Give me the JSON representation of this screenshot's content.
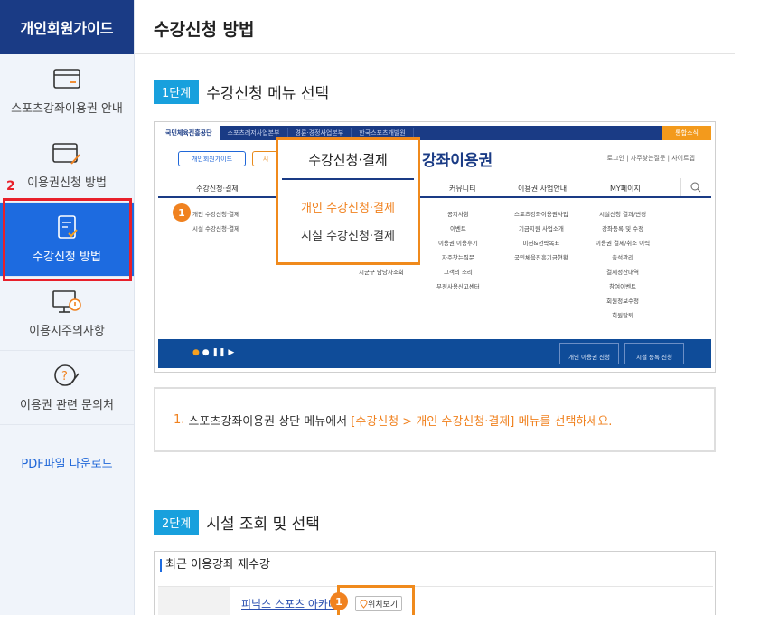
{
  "sidebar": {
    "header": "개인회원가이드",
    "step_marker": "2",
    "items": [
      {
        "label": "스포츠강좌이용권 안내"
      },
      {
        "label": "이용권신청 방법"
      },
      {
        "label": "수강신청 방법"
      },
      {
        "label": "이용시주의사항"
      },
      {
        "label": "이용권 관련 문의처"
      }
    ],
    "pdf": "PDF파일 다운로드",
    "active_index": 2
  },
  "main": {
    "title": "수강신청 방법",
    "step1": {
      "badge": "1단계",
      "title": "수강신청 메뉴 선택"
    },
    "step2": {
      "badge": "2단계",
      "title": "시설 조회 및 선택"
    }
  },
  "screenshot1": {
    "topbar": [
      "국민체육진흥공단",
      "스포츠레저사업본부",
      "경륜·경정사업본부",
      "한국스포츠개발원"
    ],
    "news": "통합소식",
    "guide_btn": "개인회원가이드",
    "guide_btn2": "시",
    "brand": "강좌이용권",
    "util": "로그인 | 자주찾는질문 | 사이트맵",
    "nav": [
      "수강신청·결제",
      "커뮤니티",
      "이용권 사업안내",
      "MY페이지"
    ],
    "col1": [
      "개인 수강신청·결제",
      "시설 수강신청·결제"
    ],
    "col_extra": "시군구 담당자조회",
    "col_community": [
      "공지사항",
      "이벤트",
      "이용권 이용후기",
      "자주찻는질문",
      "고객의 소리",
      "부정사용신고센터"
    ],
    "col_business": [
      "스포츠강좌이용권사업",
      "기금지원 사업소개",
      "미션&전략목표",
      "국민체육진흥기금현황"
    ],
    "col_my": [
      "시설신청 결과/변경",
      "강좌등록 및 수정",
      "이용권 결제/취소 이력",
      "출석관리",
      "결제정산내역",
      "참여이벤트",
      "회원정보수정",
      "회원탈퇴"
    ],
    "banner_btn1": "개인 이용권 신청",
    "banner_btn2": "시설 등록 신청",
    "badge": "1",
    "popup": {
      "title": "수강신청·결제",
      "link_active": "개인 수강신청·결제",
      "link_other": "시설 수강신청·결제"
    }
  },
  "description": {
    "number": "1.",
    "prefix": "스포츠강좌이용권 상단 메뉴에서",
    "highlight": "[수강신청 > 개인 수강신청·결제] 메뉴를 선택하세요."
  },
  "screenshot2": {
    "title": "최근 이용강좌 재수강",
    "facility": "피닉스 스포츠 아카데",
    "badge": "1",
    "location_btn": "위치보기"
  },
  "colors": {
    "navy": "#1a3b85",
    "blue": "#1d6be0",
    "orange": "#f08220",
    "red": "#e8202a",
    "cyan": "#18a0dd"
  }
}
